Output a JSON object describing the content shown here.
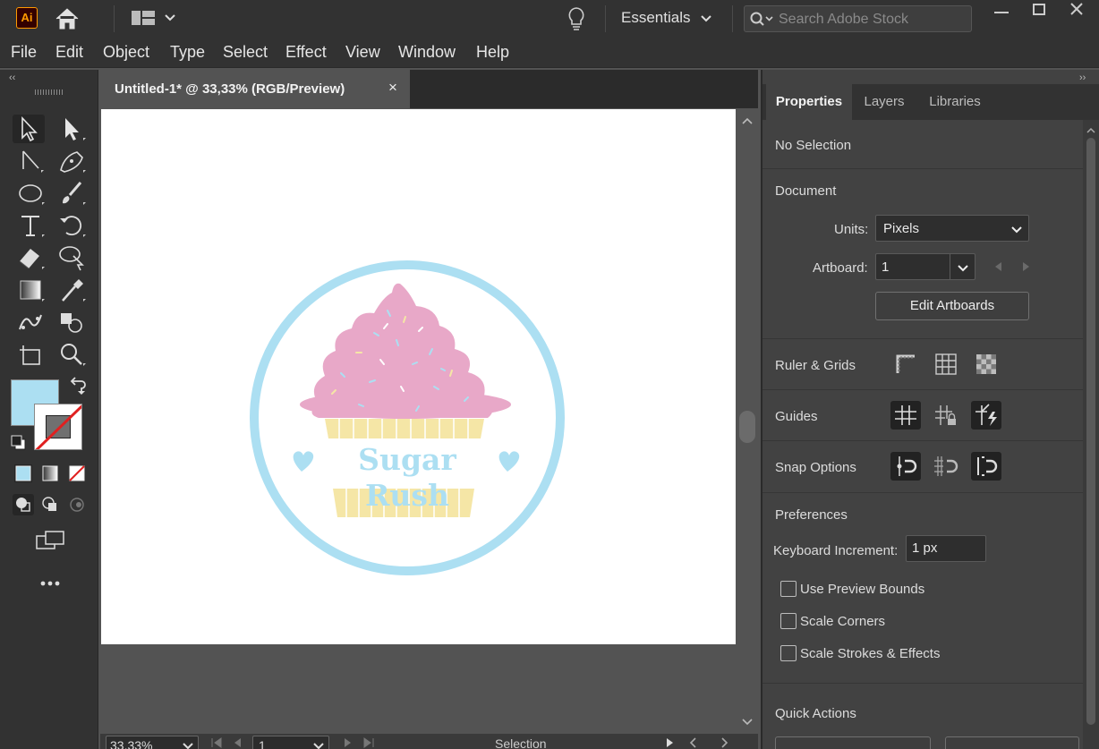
{
  "app": {
    "logo_text": "Ai",
    "workspace": "Essentials",
    "search_placeholder": "Search Adobe Stock"
  },
  "menu": [
    "File",
    "Edit",
    "Object",
    "Type",
    "Select",
    "Effect",
    "View",
    "Window",
    "Help"
  ],
  "document": {
    "tab_title": "Untitled-1* @ 33,33% (RGB/Preview)",
    "close_glyph": "×",
    "artwork_text": "Sugar Rush"
  },
  "status": {
    "zoom": "33,33%",
    "artboard": "1",
    "tool": "Selection"
  },
  "colors": {
    "fill": "#acdff2",
    "frosting": "#e8a8c8",
    "wrapper": "#f5e6a6",
    "brand_blue": "#acdff2"
  },
  "properties": {
    "tabs": [
      "Properties",
      "Layers",
      "Libraries"
    ],
    "selection": "No Selection",
    "document_heading": "Document",
    "units_label": "Units:",
    "units_value": "Pixels",
    "artboard_label": "Artboard:",
    "artboard_value": "1",
    "edit_artboards": "Edit Artboards",
    "ruler_grids": "Ruler & Grids",
    "guides": "Guides",
    "snap_options": "Snap Options",
    "preferences": "Preferences",
    "keyboard_increment_label": "Keyboard Increment:",
    "keyboard_increment_value": "1 px",
    "checkboxes": [
      "Use Preview Bounds",
      "Scale Corners",
      "Scale Strokes & Effects"
    ],
    "quick_actions": "Quick Actions"
  }
}
